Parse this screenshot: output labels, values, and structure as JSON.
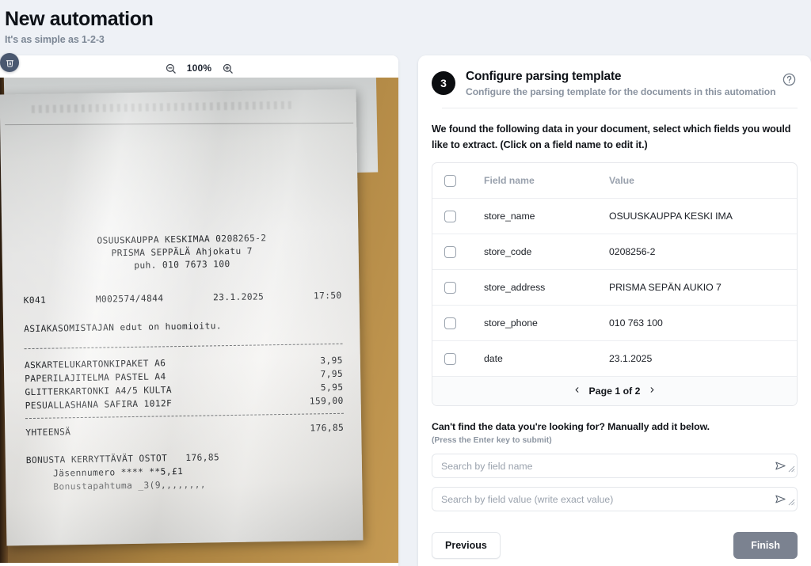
{
  "header": {
    "title": "New automation",
    "subtitle": "It's as simple as 1-2-3"
  },
  "viewer": {
    "zoom_level": "100%",
    "zoom_out_icon": "zoom-out-icon",
    "zoom_in_icon": "zoom-in-icon",
    "delete_icon": "trash-icon",
    "receipt": {
      "line1": "OSUUSKAUPPA KESKIMAA 0208265-2",
      "line2": "PRISMA SEPPÄLÄ Ahjokatu 7",
      "line3": "puh. 010 7673 100",
      "register": "K041",
      "transaction": "M002574/4844",
      "date": "23.1.2025",
      "time": "17:50",
      "notice": "ASIAKASOMISTAJAN edut on huomioitu.",
      "items": [
        {
          "name": "ASKARTELUKARTONKIPAKET A6",
          "price": "3,95"
        },
        {
          "name": "PAPERILAJITELMA PASTEL A4",
          "price": "7,95"
        },
        {
          "name": "GLITTERKARTONKI A4/5 KULTA",
          "price": "5,95"
        },
        {
          "name": "PESUALLASHANA SAFIRA 1012F",
          "price": "159,00"
        }
      ],
      "total_label": "YHTEENSÄ",
      "total_value": "176,85",
      "bonus_label": "BONUSTA KERRYTTÄVÄT OSTOT",
      "bonus_value": "176,85",
      "member_line": "Jäsennumero ****  **5,£1",
      "bonus_event_line": "Bonustapahtuma _3(9,,,,,,,,"
    }
  },
  "step": {
    "number": "3",
    "title": "Configure parsing template",
    "subtitle": "Configure the parsing template for the documents in this automation",
    "help_icon": "help-circle-icon",
    "intro": "We found the following data in your document, select which fields you would like to extract. (Click on a field name to edit it.)"
  },
  "table": {
    "columns": [
      "Field name",
      "Value"
    ],
    "rows": [
      {
        "field": "store_name",
        "value": "OSUUSKAUPPA KESKI IMA"
      },
      {
        "field": "store_code",
        "value": "0208256-2"
      },
      {
        "field": "store_address",
        "value": "PRISMA SEPÄN AUKIO 7"
      },
      {
        "field": "store_phone",
        "value": "010 763 100"
      },
      {
        "field": "date",
        "value": "23.1.2025"
      }
    ],
    "pagination": {
      "label": "Page 1 of 2",
      "prev_icon": "chevron-left-icon",
      "next_icon": "chevron-right-icon"
    }
  },
  "manual": {
    "title": "Can't find the data you're looking for? Manually add it below.",
    "hint": "(Press the Enter key to submit)",
    "field_name_placeholder": "Search by field name",
    "field_name_value": "",
    "field_value_placeholder": "Search by field value (write exact value)",
    "field_value_value": "",
    "send_icon": "send-icon"
  },
  "footer": {
    "previous_label": "Previous",
    "finish_label": "Finish"
  },
  "colors": {
    "page_background": "#eef1f6",
    "step_badge": "#0b0d10",
    "finish_button": "#7b8290",
    "trash_fab": "#4a5870"
  }
}
